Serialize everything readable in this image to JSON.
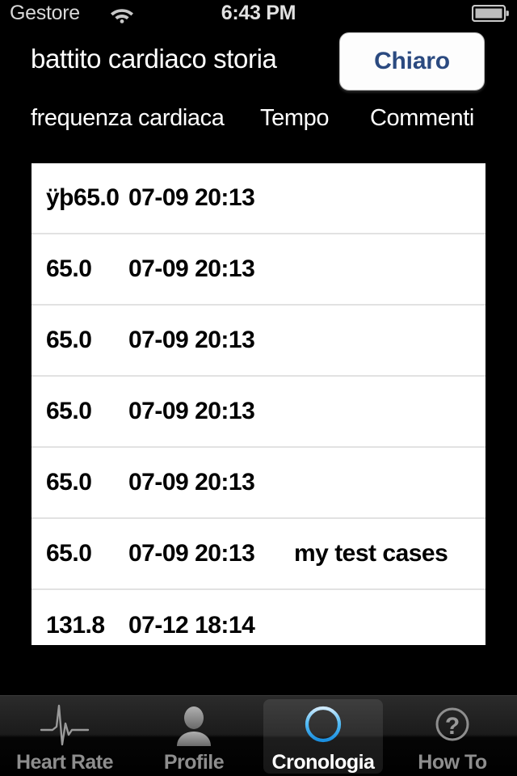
{
  "statusbar": {
    "carrier": "Gestore",
    "wifi_icon": "wifi-icon",
    "time": "6:43 PM",
    "battery_icon": "battery-icon"
  },
  "header": {
    "title": "battito cardiaco storia",
    "action_button": "Chiaro"
  },
  "table": {
    "columns": [
      "frequenza cardiaca",
      "Tempo",
      "Commenti"
    ],
    "rows": [
      {
        "rate": "ÿþ65.0",
        "time": "07-09 20:13",
        "comment": ""
      },
      {
        "rate": "65.0",
        "time": "07-09 20:13",
        "comment": ""
      },
      {
        "rate": "65.0",
        "time": "07-09 20:13",
        "comment": ""
      },
      {
        "rate": "65.0",
        "time": "07-09 20:13",
        "comment": ""
      },
      {
        "rate": "65.0",
        "time": "07-09 20:13",
        "comment": ""
      },
      {
        "rate": "65.0",
        "time": "07-09 20:13",
        "comment": "my test cases"
      },
      {
        "rate": "131.8",
        "time": "07-12 18:14",
        "comment": ""
      }
    ]
  },
  "tabbar": {
    "tabs": [
      {
        "label": "Heart Rate",
        "icon": "ecg-waveform-icon",
        "active": false
      },
      {
        "label": "Profile",
        "icon": "person-icon",
        "active": false
      },
      {
        "label": "Cronologia",
        "icon": "clock-icon",
        "active": true
      },
      {
        "label": "How To",
        "icon": "question-mark-circle-icon",
        "active": false
      }
    ]
  },
  "colors": {
    "background": "#000000",
    "table_bg": "#ffffff",
    "separator": "#e2e2e2",
    "accent_blue": "#2b4a80",
    "clock_blue": "#3ab4f2",
    "tab_inactive": "#8e8e8e"
  }
}
